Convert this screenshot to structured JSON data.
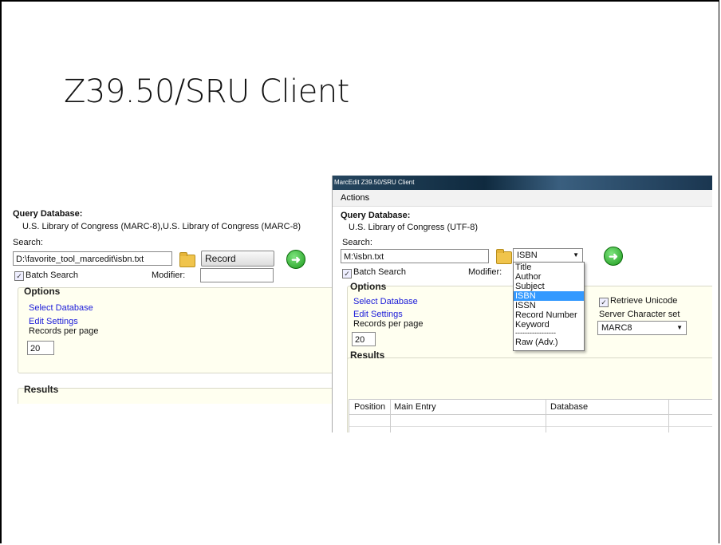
{
  "slide": {
    "title": "Z39.50/SRU Client"
  },
  "left": {
    "query_label": "Query Database:",
    "query_value": "U.S. Library of Congress (MARC-8),U.S. Library of Congress (MARC-8)",
    "search_label": "Search:",
    "search_value": "D:\\favorite_tool_marcedit\\isbn.txt",
    "search_type": "Record Number",
    "batch_label": "Batch Search",
    "modifier_label": "Modifier:",
    "options_label": "Options",
    "select_db": "Select Database",
    "edit_settings": "Edit Settings",
    "records_label": "Records per page",
    "records_value": "20",
    "results_label": "Results"
  },
  "right": {
    "window_title": "MarcEdit Z39.50/SRU Client",
    "menu_actions": "Actions",
    "query_label": "Query Database:",
    "query_value": "U.S. Library of Congress (UTF-8)",
    "search_label": "Search:",
    "search_value": "M:\\isbn.txt",
    "search_type": "ISBN",
    "batch_label": "Batch Search",
    "modifier_label": "Modifier:",
    "options_label": "Options",
    "select_db": "Select Database",
    "edit_settings": "Edit Settings",
    "records_label": "Records per page",
    "records_value": "20",
    "retrieve_unicode": "Retrieve Unicode",
    "charset_label": "Server Character set",
    "charset_value": "MARC8",
    "results_label": "Results",
    "dropdown_options": [
      "Title",
      "Author",
      "Subject",
      "ISBN",
      "ISSN",
      "Record Number",
      "Keyword",
      "-----------------",
      "Raw (Adv.)"
    ],
    "columns": [
      "Position",
      "Main Entry",
      "Database"
    ]
  }
}
